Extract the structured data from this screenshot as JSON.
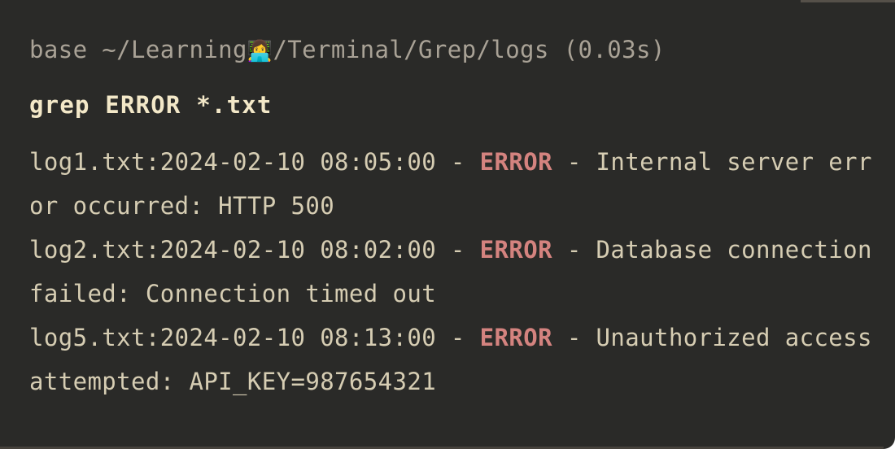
{
  "terminal": {
    "theme": {
      "background": "#2a2a28",
      "prompt_color": "#a9a296",
      "command_color": "#f3e8c8",
      "output_color": "#d6cdb3",
      "match_color": "#d4837f",
      "page_background": "#ffffff"
    },
    "prompt": {
      "env": "base",
      "path_before_emoji": "base ~/Learning",
      "emoji": "👩‍💻",
      "emoji_name": "woman-technologist-emoji",
      "path_after_emoji": "/Terminal/Grep/logs",
      "duration": "(0.03s)"
    },
    "command": {
      "text": "grep ERROR *.txt",
      "program": "grep",
      "pattern": "ERROR",
      "glob": "*.txt"
    },
    "results": [
      {
        "file": "log1.txt",
        "prefix": "log1.txt:2024-02-10 08:05:00 - ",
        "match": "ERROR",
        "suffix": " - Internal server error occurred: HTTP 500",
        "timestamp": "2024-02-10 08:05:00",
        "message": "Internal server error occurred: HTTP 500"
      },
      {
        "file": "log2.txt",
        "prefix": "log2.txt:2024-02-10 08:02:00 - ",
        "match": "ERROR",
        "suffix": " - Database connection failed: Connection timed out",
        "timestamp": "2024-02-10 08:02:00",
        "message": "Database connection failed: Connection timed out"
      },
      {
        "file": "log5.txt",
        "prefix": "log5.txt:2024-02-10 08:13:00 - ",
        "match": "ERROR",
        "suffix": " - Unauthorized access attempted: API_KEY=987654321",
        "timestamp": "2024-02-10 08:13:00",
        "message": "Unauthorized access attempted: API_KEY=987654321"
      }
    ]
  }
}
